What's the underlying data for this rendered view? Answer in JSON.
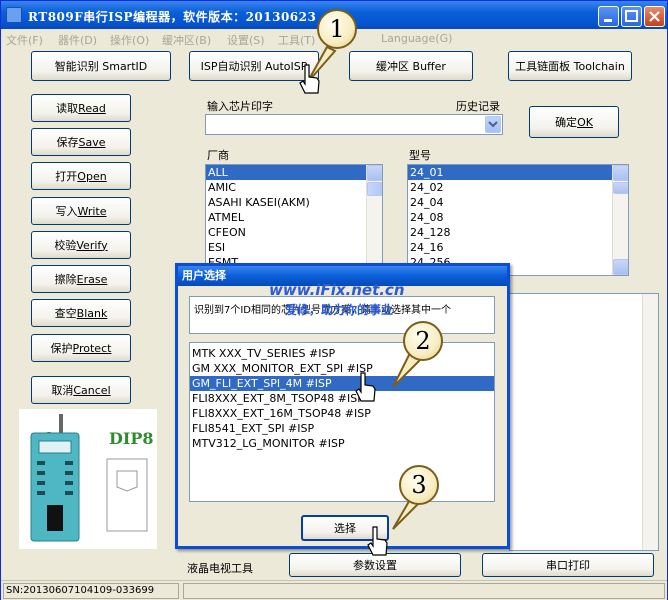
{
  "window": {
    "title": "RT809F串行ISP编程器，软件版本：20130623"
  },
  "menu": [
    {
      "label": "文件(F)"
    },
    {
      "label": "器件(D)"
    },
    {
      "label": "操作(O)"
    },
    {
      "label": "缓冲区(B)"
    },
    {
      "label": "设置(S)"
    },
    {
      "label": "工具(T)"
    },
    {
      "label": "Language(G)"
    }
  ],
  "toolbar": {
    "smartid": "智能识别 SmartID",
    "autoisp": "ISP自动识别 AutoISP",
    "buffer": "缓冲区 Buffer",
    "toolchain": "工具链面板 Toolchain"
  },
  "side_buttons": [
    {
      "zh": "读取 ",
      "en": "Read"
    },
    {
      "zh": "保存 ",
      "en": "Save"
    },
    {
      "zh": "打开 ",
      "en": "Open"
    },
    {
      "zh": "写入 ",
      "en": "Write"
    },
    {
      "zh": "校验 ",
      "en": "Verify"
    },
    {
      "zh": "擦除 ",
      "en": "Erase"
    },
    {
      "zh": "查空 ",
      "en": "Blank"
    },
    {
      "zh": "保护 ",
      "en": "Protect"
    },
    {
      "zh": "取消 ",
      "en": "Cancel"
    }
  ],
  "chip_input": {
    "label": "输入芯片印字",
    "history_label": "历史记录",
    "value": ""
  },
  "ok_button": {
    "zh": "确定 ",
    "en": "OK"
  },
  "vendor": {
    "label": "厂商",
    "items": [
      "ALL",
      "AMIC",
      "ASAHI KASEI(AKM)",
      "ATMEL",
      "CFEON",
      "ESI",
      "ESMT"
    ],
    "selected": 0
  },
  "model": {
    "label": "型号",
    "items": [
      "24_01",
      "24_02",
      "24_04",
      "24_08",
      "24_128",
      "24_16",
      "24_256"
    ],
    "selected": 0
  },
  "dip_label": "DIP8",
  "dialog": {
    "title": "用户选择",
    "message": "识别到7个ID相同的芯片型号或方案，请手动选择其中一个",
    "options": [
      "MTK XXX_TV_SERIES #ISP",
      "GM XXX_MONITOR_EXT_SPI #ISP",
      "GM_FLI_EXT_SPI_4M #ISP",
      "FLI8XXX_EXT_8M_TSOP48 #ISP",
      "FLI8XXX_EXT_16M_TSOP48 #ISP",
      "FLI8541_EXT_SPI #ISP",
      "MTV312_LG_MONITOR #ISP"
    ],
    "selected": 2,
    "select_button": "选择"
  },
  "watermark": {
    "url": "www.iFix.net.cn",
    "slogan": "爱修，助力你的事业"
  },
  "bottom": {
    "lcd_tools": "液晶电视工具",
    "params": "参数设置",
    "serial_print": "串口打印"
  },
  "status": {
    "sn": "SN:20130607104109-033699"
  },
  "callouts": [
    "1",
    "2",
    "3"
  ],
  "colors": {
    "titlebar": "#0a5fd8",
    "selection": "#316ac5",
    "dip_text": "#2e8b2e"
  }
}
